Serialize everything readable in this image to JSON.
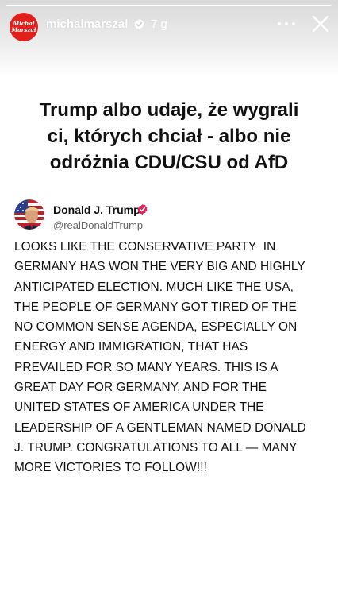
{
  "story": {
    "progress_fraction": 1.0,
    "account": {
      "username": "michalmarszal",
      "avatar_lines": [
        "Michał",
        "Marszał"
      ],
      "avatar_color": "#e0201c",
      "verified": true,
      "time_ago": "7 g"
    },
    "icons": {
      "more": "more-dots-icon",
      "close": "close-icon"
    }
  },
  "headline": {
    "lines": [
      "Trump albo udaje, że wygrali",
      "ci, których chciał - albo nie",
      "odróżnia CDU/CSU od AfD"
    ]
  },
  "tweet": {
    "author_name": "Donald J. Trump",
    "author_handle": "@realDonaldTrump",
    "verified_color": "#e0245e",
    "lines": [
      "LOOKS LIKE THE CONSERVATIVE PARTY  IN",
      "GERMANY HAS WON THE VERY BIG AND HIGHLY",
      "ANTICIPATED ELECTION. MUCH LIKE THE USA,",
      "THE PEOPLE OF GERMANY GOT TIRED OF THE",
      "NO COMMON SENSE AGENDA, ESPECIALLY ON",
      "ENERGY AND IMMIGRATION, THAT HAS",
      "PREVAILED FOR SO MANY YEARS. THIS IS A",
      "GREAT DAY FOR GERMANY, AND FOR THE",
      "UNITED STATES OF AMERICA UNDER THE",
      "LEADERSHIP OF A GENTLEMAN NAMED DONALD",
      "J. TRUMP. CONGRATULATIONS TO ALL — MANY",
      "MORE VICTORIES TO FOLLOW!!!"
    ]
  }
}
